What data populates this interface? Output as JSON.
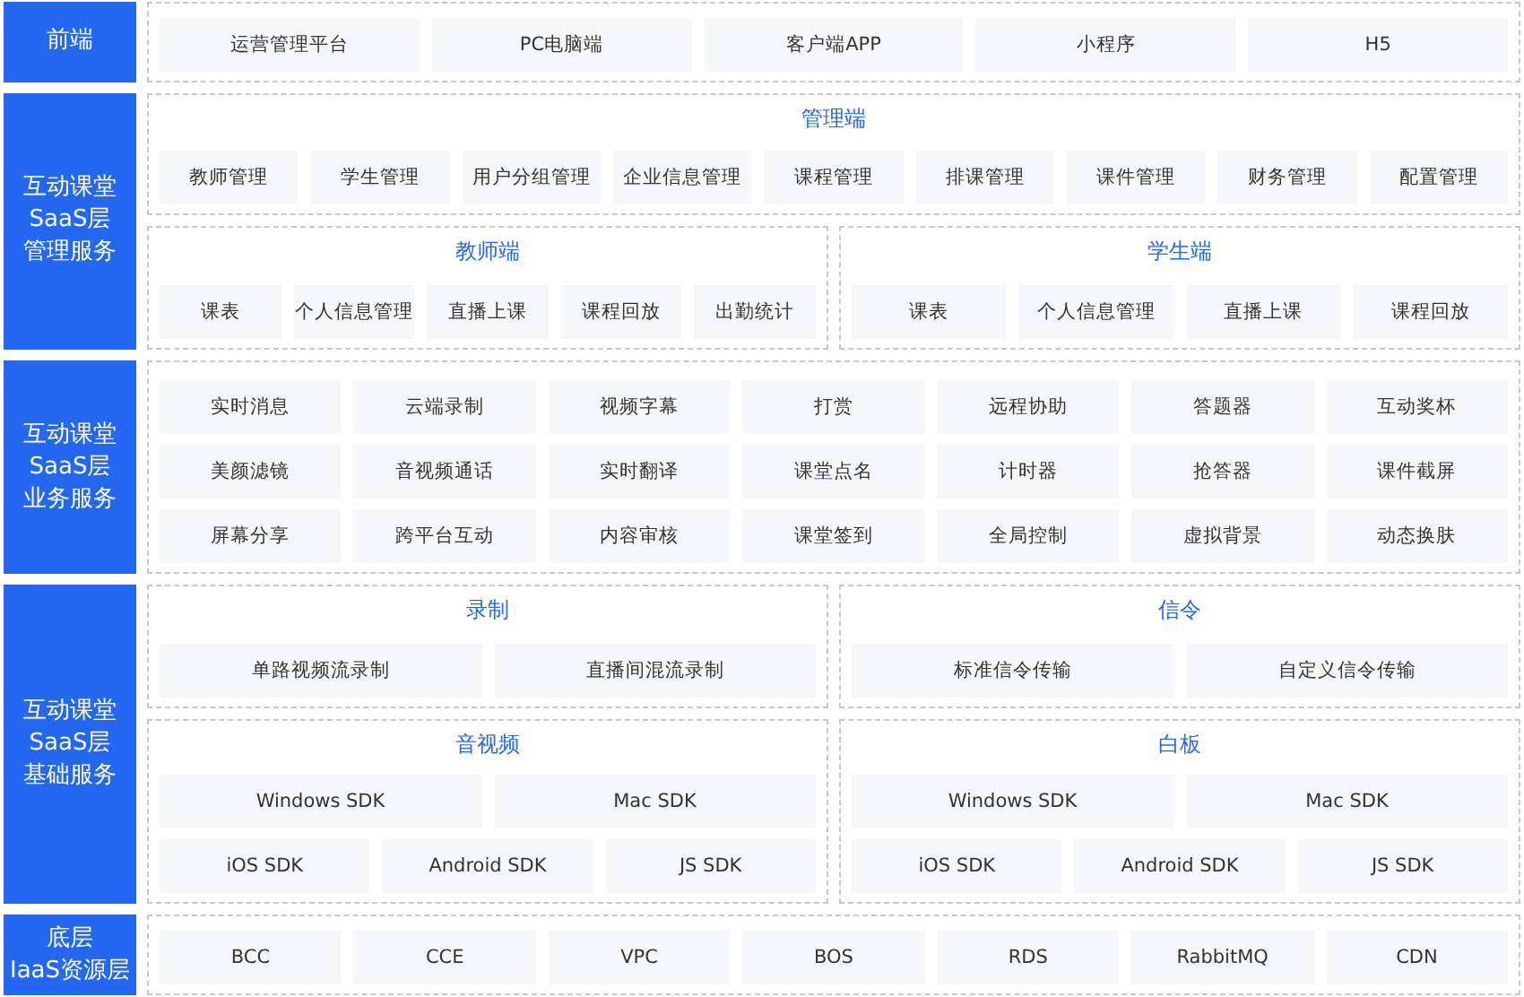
{
  "layers": [
    {
      "label": [
        "前端"
      ],
      "groups": [
        [
          {
            "rows": [
              [
                "运营管理平台",
                "PC电脑端",
                "客户端APP",
                "小程序",
                "H5"
              ]
            ]
          }
        ]
      ]
    },
    {
      "label": [
        "互动课堂",
        "SaaS层",
        "管理服务"
      ],
      "groups": [
        [
          {
            "title": "管理端",
            "rows": [
              [
                "教师管理",
                "学生管理",
                "用户分组管理",
                "企业信息管理",
                "课程管理",
                "排课管理",
                "课件管理",
                "财务管理",
                "配置管理"
              ]
            ]
          }
        ],
        [
          {
            "title": "教师端",
            "rows": [
              [
                "课表",
                "个人信息管理",
                "直播上课",
                "课程回放",
                "出勤统计"
              ]
            ]
          },
          {
            "title": "学生端",
            "rows": [
              [
                "课表",
                "个人信息管理",
                "直播上课",
                "课程回放"
              ]
            ]
          }
        ]
      ]
    },
    {
      "label": [
        "互动课堂",
        "SaaS层",
        "业务服务"
      ],
      "groups": [
        [
          {
            "rows": [
              [
                "实时消息",
                "云端录制",
                "视频字幕",
                "打赏",
                "远程协助",
                "答题器",
                "互动奖杯"
              ],
              [
                "美颜滤镜",
                "音视频通话",
                "实时翻译",
                "课堂点名",
                "计时器",
                "抢答器",
                "课件截屏"
              ],
              [
                "屏幕分享",
                "跨平台互动",
                "内容审核",
                "课堂签到",
                "全局控制",
                "虚拟背景",
                "动态换肤"
              ]
            ]
          }
        ]
      ]
    },
    {
      "label": [
        "互动课堂",
        "SaaS层",
        "基础服务"
      ],
      "groups": [
        [
          {
            "title": "录制",
            "rows": [
              [
                "单路视频流录制",
                "直播间混流录制"
              ]
            ]
          },
          {
            "title": "信令",
            "rows": [
              [
                "标准信令传输",
                "自定义信令传输"
              ]
            ]
          }
        ],
        [
          {
            "title": "音视频",
            "rows": [
              [
                "Windows SDK",
                "Mac SDK"
              ],
              [
                "iOS SDK",
                "Android SDK",
                "JS SDK"
              ]
            ]
          },
          {
            "title": "白板",
            "rows": [
              [
                "Windows SDK",
                "Mac SDK"
              ],
              [
                "iOS SDK",
                "Android SDK",
                "JS SDK"
              ]
            ]
          }
        ]
      ]
    },
    {
      "label": [
        "底层",
        "IaaS资源层"
      ],
      "groups": [
        [
          {
            "rows": [
              [
                "BCC",
                "CCE",
                "VPC",
                "BOS",
                "RDS",
                "RabbitMQ",
                "CDN"
              ]
            ]
          }
        ]
      ]
    }
  ]
}
